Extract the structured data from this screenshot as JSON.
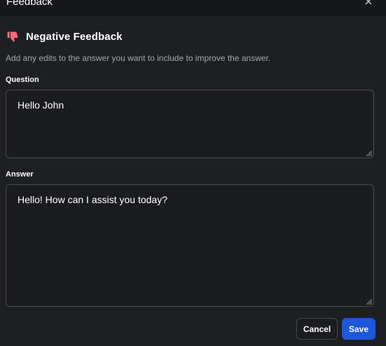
{
  "dialog": {
    "window_title": "Feedback",
    "heading": "Negative Feedback",
    "description": "Add any edits to the answer you want to include to improve the answer."
  },
  "question": {
    "label": "Question",
    "value": "Hello John"
  },
  "answer": {
    "label": "Answer",
    "value": "Hello! How can I assist you today?"
  },
  "actions": {
    "cancel_label": "Cancel",
    "save_label": "Save"
  },
  "icons": {
    "heading_icon": "thumbs-down-icon",
    "close_icon": "close-icon"
  },
  "colors": {
    "background": "#1e1f23",
    "accent": "#1f57d9",
    "thumb_icon": "#f06b7b",
    "muted_text": "#a3a6ae"
  }
}
